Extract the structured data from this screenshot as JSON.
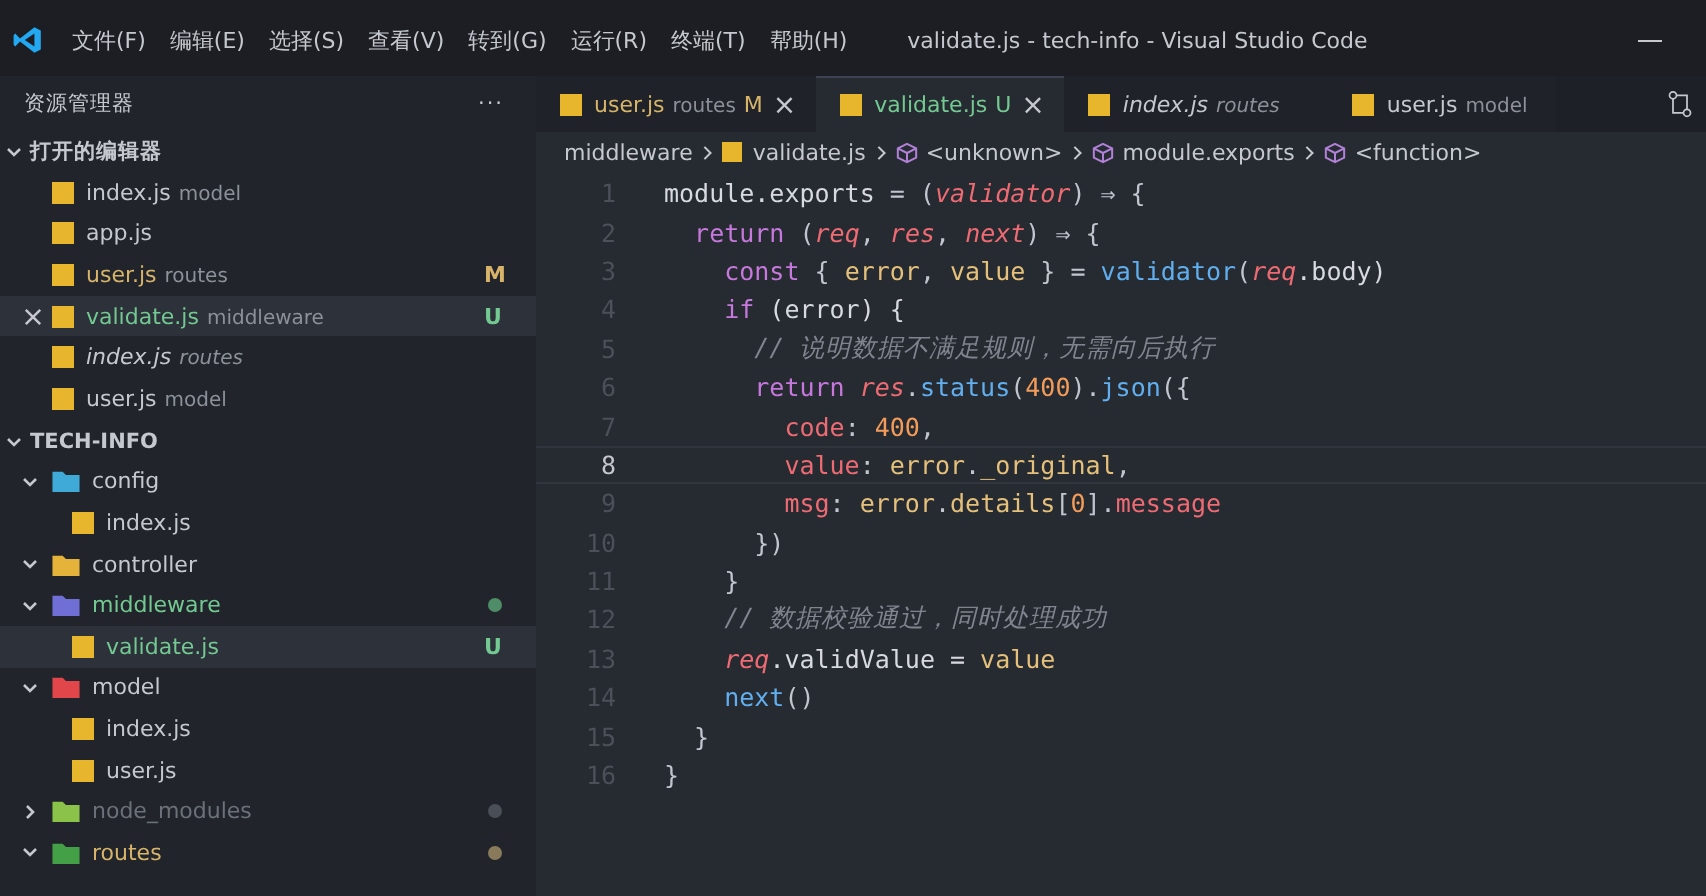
{
  "menu": [
    "文件(F)",
    "编辑(E)",
    "选择(S)",
    "查看(V)",
    "转到(G)",
    "运行(R)",
    "终端(T)",
    "帮助(H)"
  ],
  "window": {
    "title": "validate.js - tech-info - Visual Studio Code"
  },
  "sidebar": {
    "title": "资源管理器",
    "more": "···",
    "open_editors": {
      "title": "打开的编辑器",
      "expanded": true,
      "items": [
        {
          "name": "index.js",
          "desc": "model",
          "selected": false,
          "preview": false,
          "modified": false,
          "untracked": false
        },
        {
          "name": "app.js",
          "selected": false,
          "preview": false,
          "modified": false,
          "untracked": false
        },
        {
          "name": "user.js",
          "desc": "routes",
          "badge": "M",
          "selected": false,
          "preview": false,
          "modified": true,
          "untracked": false
        },
        {
          "name": "validate.js",
          "desc": "middleware",
          "badge": "U",
          "selected": true,
          "preview": false,
          "modified": false,
          "untracked": true
        },
        {
          "name": "index.js",
          "desc": "routes",
          "selected": false,
          "preview": true,
          "modified": false,
          "untracked": false
        },
        {
          "name": "user.js",
          "desc": "model",
          "selected": false,
          "preview": false,
          "modified": false,
          "untracked": false
        }
      ]
    },
    "project": {
      "title": "TECH-INFO",
      "expanded": true,
      "tree": [
        {
          "name": "config",
          "color": "#3fa9d8",
          "expanded": true,
          "modified": false,
          "untracked": false,
          "ignored": false,
          "children": [
            {
              "name": "index.js",
              "selected": false,
              "untracked": false
            }
          ]
        },
        {
          "name": "controller",
          "color": "#e5b33a",
          "expanded": true,
          "modified": false,
          "untracked": false,
          "ignored": false
        },
        {
          "name": "middleware",
          "color": "#6f6fd6",
          "expanded": true,
          "modified": false,
          "untracked": true,
          "ignored": false,
          "children": [
            {
              "name": "validate.js",
              "selected": true,
              "untracked": true,
              "badge": "U"
            }
          ]
        },
        {
          "name": "model",
          "color": "#e0464a",
          "expanded": true,
          "modified": false,
          "untracked": false,
          "ignored": false,
          "children": [
            {
              "name": "index.js",
              "selected": false,
              "untracked": false
            },
            {
              "name": "user.js",
              "selected": false,
              "untracked": false
            }
          ]
        },
        {
          "name": "node_modules",
          "color": "#8bc34a",
          "expanded": false,
          "modified": false,
          "untracked": false,
          "ignored": true
        },
        {
          "name": "routes",
          "color": "#43a047",
          "expanded": true,
          "modified": true,
          "untracked": false,
          "ignored": false
        }
      ]
    }
  },
  "tabs": [
    {
      "name": "user.js",
      "desc": "routes",
      "badge": "M",
      "selected": false,
      "preview": false,
      "modified": true,
      "untracked": false,
      "close": "×"
    },
    {
      "name": "validate.js",
      "badge": "U",
      "selected": true,
      "preview": false,
      "modified": false,
      "untracked": true,
      "close": "×"
    },
    {
      "name": "index.js",
      "desc": "routes",
      "selected": false,
      "preview": true,
      "modified": false,
      "untracked": false
    },
    {
      "name": "user.js",
      "desc": "model",
      "selected": false,
      "preview": false,
      "modified": false,
      "untracked": false
    }
  ],
  "breadcrumbs": [
    {
      "kind": "folder",
      "text": "middleware"
    },
    {
      "kind": "file",
      "text": "validate.js"
    },
    {
      "kind": "symbol",
      "text": "<unknown>"
    },
    {
      "kind": "symbol",
      "text": "module.exports"
    },
    {
      "kind": "symbol",
      "text": "<function>"
    }
  ],
  "code": [
    {
      "n": "1",
      "current": false,
      "tokens": [
        {
          "t": "module.exports",
          "kind": "plain"
        },
        {
          "t": " = (",
          "kind": "op"
        },
        {
          "t": "validator",
          "kind": "param"
        },
        {
          "t": ") ⇒ {",
          "kind": "op"
        }
      ]
    },
    {
      "n": "2",
      "current": false,
      "tokens": [
        {
          "t": "  return",
          "kind": "kw"
        },
        {
          "t": " (",
          "kind": "op"
        },
        {
          "t": "req",
          "kind": "param"
        },
        {
          "t": ", ",
          "kind": "op"
        },
        {
          "t": "res",
          "kind": "param"
        },
        {
          "t": ", ",
          "kind": "op"
        },
        {
          "t": "next",
          "kind": "param"
        },
        {
          "t": ") ⇒ {",
          "kind": "op"
        }
      ]
    },
    {
      "n": "3",
      "current": false,
      "tokens": [
        {
          "t": "    const",
          "kind": "kw"
        },
        {
          "t": " { ",
          "kind": "op"
        },
        {
          "t": "error",
          "kind": "var"
        },
        {
          "t": ", ",
          "kind": "op"
        },
        {
          "t": "value",
          "kind": "var"
        },
        {
          "t": " } = ",
          "kind": "op"
        },
        {
          "t": "validator",
          "kind": "fn"
        },
        {
          "t": "(",
          "kind": "op"
        },
        {
          "t": "req",
          "kind": "param"
        },
        {
          "t": ".body)",
          "kind": "plain"
        }
      ]
    },
    {
      "n": "4",
      "current": false,
      "tokens": [
        {
          "t": "    if",
          "kind": "kw"
        },
        {
          "t": " (error) {",
          "kind": "plain"
        }
      ]
    },
    {
      "n": "5",
      "current": false,
      "tokens": [
        {
          "t": "      // 说明数据不满足规则，无需向后执行",
          "kind": "cmt"
        }
      ]
    },
    {
      "n": "6",
      "current": false,
      "tokens": [
        {
          "t": "      return ",
          "kind": "kw"
        },
        {
          "t": "res",
          "kind": "param"
        },
        {
          "t": ".",
          "kind": "op"
        },
        {
          "t": "status",
          "kind": "fn"
        },
        {
          "t": "(",
          "kind": "op"
        },
        {
          "t": "400",
          "kind": "num"
        },
        {
          "t": ").",
          "kind": "op"
        },
        {
          "t": "json",
          "kind": "fn"
        },
        {
          "t": "({",
          "kind": "op"
        }
      ]
    },
    {
      "n": "7",
      "current": false,
      "tokens": [
        {
          "t": "        code",
          "kind": "prop"
        },
        {
          "t": ": ",
          "kind": "op"
        },
        {
          "t": "400",
          "kind": "num"
        },
        {
          "t": ",",
          "kind": "op"
        }
      ]
    },
    {
      "n": "8",
      "current": true,
      "tokens": [
        {
          "t": "        value",
          "kind": "prop"
        },
        {
          "t": ": ",
          "kind": "op"
        },
        {
          "t": "error",
          "kind": "var"
        },
        {
          "t": ".",
          "kind": "op"
        },
        {
          "t": "_original",
          "kind": "var"
        },
        {
          "t": ",",
          "kind": "op"
        }
      ]
    },
    {
      "n": "9",
      "current": false,
      "tokens": [
        {
          "t": "        msg",
          "kind": "prop"
        },
        {
          "t": ": ",
          "kind": "op"
        },
        {
          "t": "error",
          "kind": "var"
        },
        {
          "t": ".",
          "kind": "op"
        },
        {
          "t": "details",
          "kind": "var"
        },
        {
          "t": "[",
          "kind": "op"
        },
        {
          "t": "0",
          "kind": "num"
        },
        {
          "t": "].",
          "kind": "op"
        },
        {
          "t": "message",
          "kind": "prop"
        }
      ]
    },
    {
      "n": "10",
      "current": false,
      "tokens": [
        {
          "t": "      })",
          "kind": "op"
        }
      ]
    },
    {
      "n": "11",
      "current": false,
      "tokens": [
        {
          "t": "    }",
          "kind": "op"
        }
      ]
    },
    {
      "n": "12",
      "current": false,
      "tokens": [
        {
          "t": "    // 数据校验通过，同时处理成功",
          "kind": "cmt"
        }
      ]
    },
    {
      "n": "13",
      "current": false,
      "tokens": [
        {
          "t": "    req",
          "kind": "param"
        },
        {
          "t": ".validValue = ",
          "kind": "plain"
        },
        {
          "t": "value",
          "kind": "var"
        }
      ]
    },
    {
      "n": "14",
      "current": false,
      "tokens": [
        {
          "t": "    next",
          "kind": "fn"
        },
        {
          "t": "()",
          "kind": "op"
        }
      ]
    },
    {
      "n": "15",
      "current": false,
      "tokens": [
        {
          "t": "  }",
          "kind": "op"
        }
      ]
    },
    {
      "n": "16",
      "current": false,
      "tokens": [
        {
          "t": "}",
          "kind": "op"
        }
      ]
    }
  ]
}
